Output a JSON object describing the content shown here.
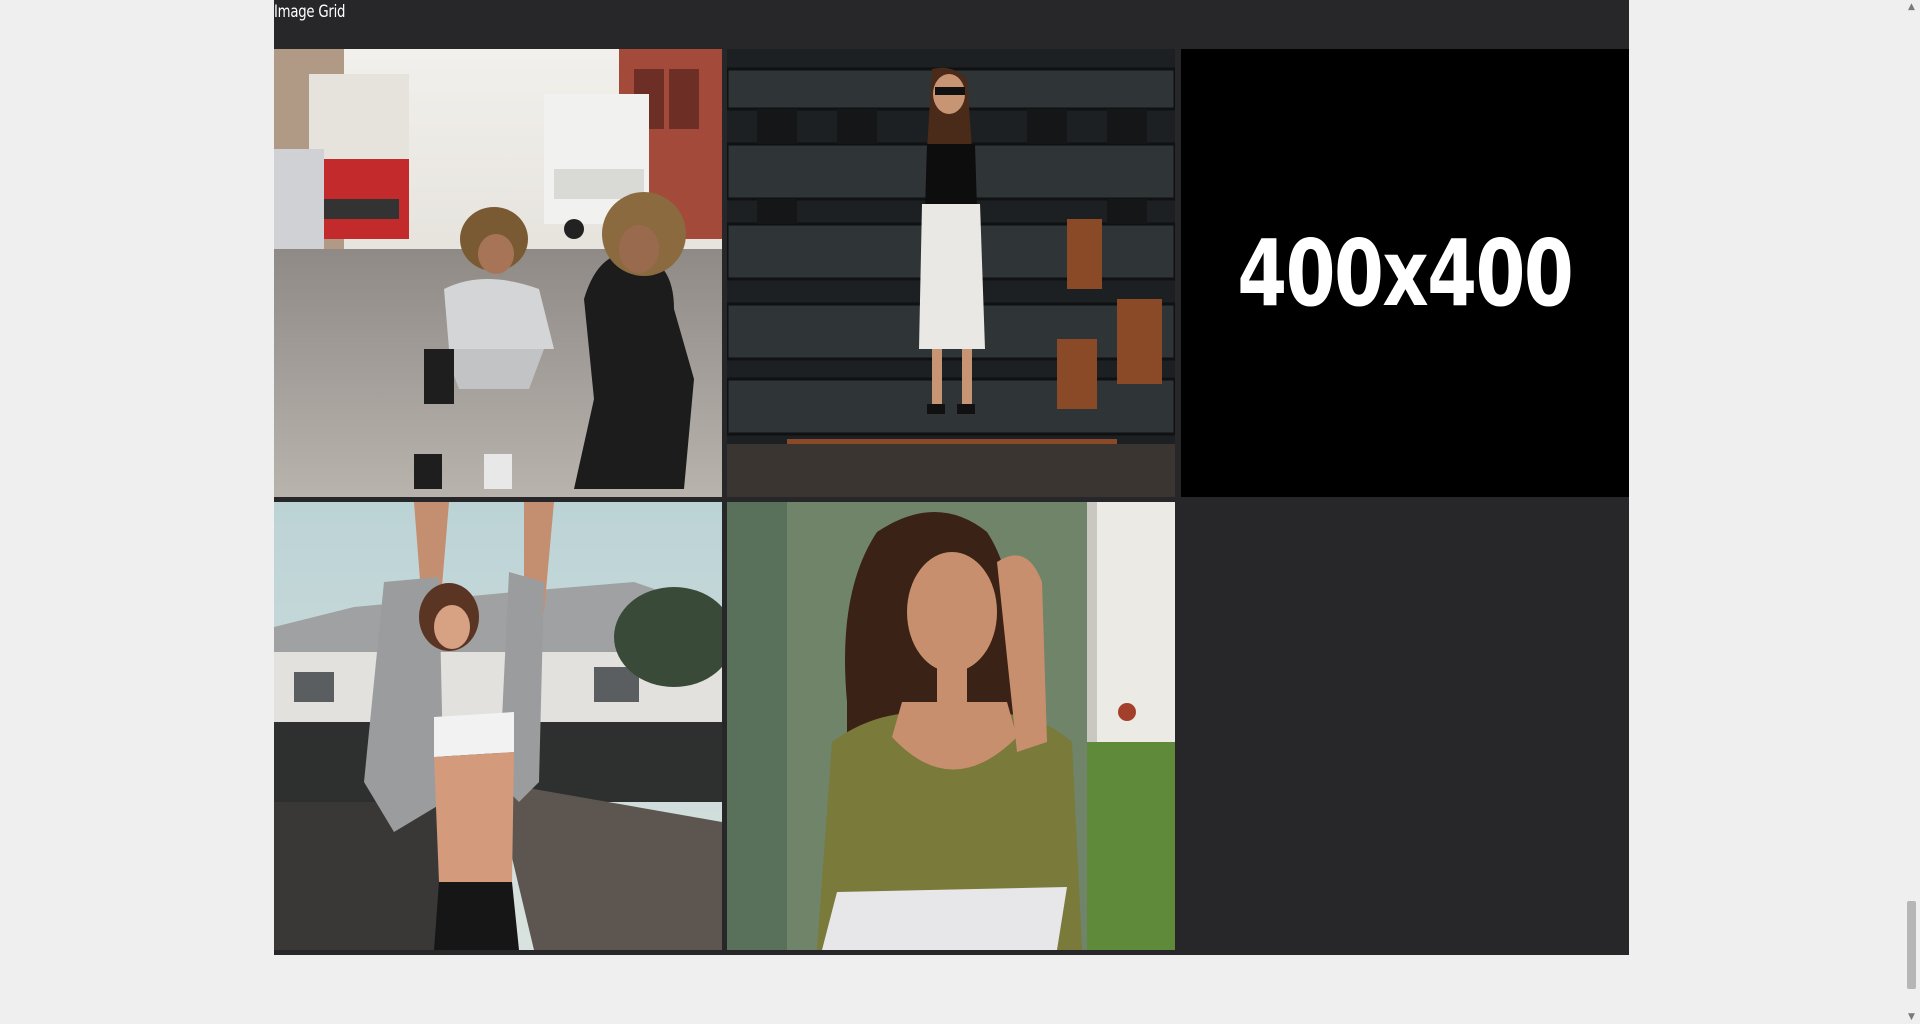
{
  "panel": {
    "title": "Image Grid"
  },
  "grid": {
    "items": [
      {
        "kind": "photo",
        "subject": "mother-and-child-on-street"
      },
      {
        "kind": "photo",
        "subject": "woman-in-white-skirt-industrial"
      },
      {
        "kind": "placeholder",
        "label": "400x400"
      },
      {
        "kind": "photo",
        "subject": "woman-stretching-on-dock"
      },
      {
        "kind": "photo",
        "subject": "woman-by-green-wall"
      }
    ]
  },
  "colors": {
    "page_bg": "#efefef",
    "panel_bg": "#272729",
    "placeholder_bg": "#000000",
    "text": "#ffffff"
  },
  "icons": {
    "scroll_up": "triangle-up",
    "scroll_down": "triangle-down"
  }
}
